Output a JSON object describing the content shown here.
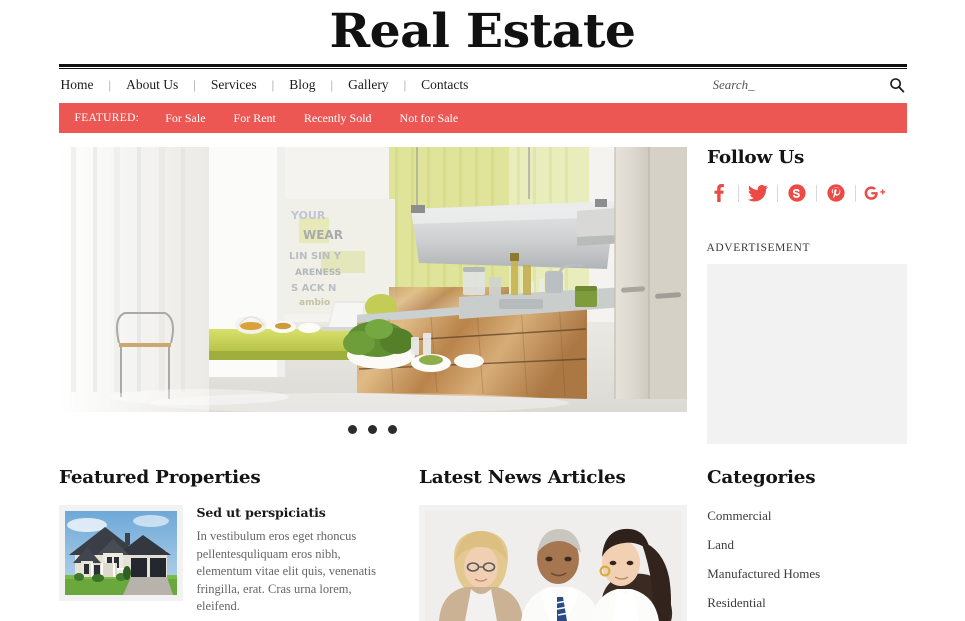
{
  "site": {
    "title": "Real Estate",
    "accent_color": "#ec5754",
    "social_color": "#ec4a45",
    "placeholder_color": "#f2f2f2"
  },
  "nav": {
    "separator": "|",
    "items": [
      {
        "label": "Home"
      },
      {
        "label": "About Us"
      },
      {
        "label": "Services"
      },
      {
        "label": "Blog"
      },
      {
        "label": "Gallery"
      },
      {
        "label": "Contacts"
      }
    ]
  },
  "search": {
    "placeholder": "Search_",
    "value": "",
    "icon": "search-icon"
  },
  "featured": {
    "label": "FEATURED:",
    "items": [
      {
        "label": "For Sale"
      },
      {
        "label": "For Rent"
      },
      {
        "label": "Recently Sold"
      },
      {
        "label": "Not for Sale"
      }
    ]
  },
  "slider": {
    "dots": [
      {
        "active": true
      },
      {
        "active": false
      },
      {
        "active": false
      }
    ],
    "alt": "modern-kitchen-interior"
  },
  "sidebar": {
    "follow": {
      "title": "Follow Us",
      "icons": [
        {
          "name": "facebook-icon",
          "glyph": "f"
        },
        {
          "name": "twitter-icon",
          "glyph": ""
        },
        {
          "name": "skype-icon",
          "glyph": "S"
        },
        {
          "name": "pinterest-icon",
          "glyph": "P"
        },
        {
          "name": "googleplus-icon",
          "glyph": "g+"
        }
      ]
    },
    "advertisement": {
      "label": "ADVERTISEMENT"
    }
  },
  "featured_properties": {
    "title": "Featured Properties",
    "items": [
      {
        "heading": "Sed ut perspiciatis",
        "text": "In vestibulum eros eget rhoncus pellentesquliquam eros nibh, elementum vitae elit quis, venenatis fringilla, erat. Cras urna lorem, eleifend.",
        "thumb_alt": "suburban-house-exterior"
      }
    ]
  },
  "latest_news": {
    "title": "Latest News Articles",
    "items": [
      {
        "image_alt": "business-meeting-three-people"
      }
    ]
  },
  "categories": {
    "title": "Categories",
    "items": [
      {
        "label": "Commercial"
      },
      {
        "label": "Land"
      },
      {
        "label": "Manufactured Homes"
      },
      {
        "label": "Residential"
      }
    ]
  }
}
